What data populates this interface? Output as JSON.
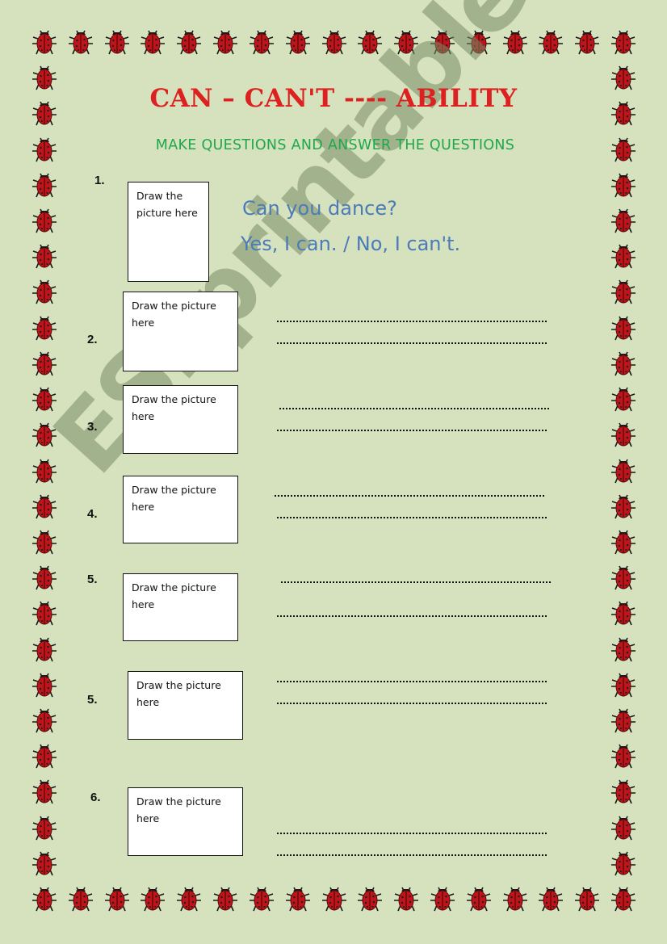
{
  "worksheet": {
    "title": "CAN – CAN'T ---- ABILITY",
    "instruction": "MAKE QUESTIONS AND ANSWER THE QUESTIONS",
    "example": {
      "question": "Can you dance?",
      "answer": "Yes, I can. / No, I can't."
    },
    "items": [
      {
        "number": "1.",
        "box_label": "Draw the picture here"
      },
      {
        "number": "2.",
        "box_label": "Draw the picture here"
      },
      {
        "number": "3.",
        "box_label": "Draw the picture here"
      },
      {
        "number": "4.",
        "box_label": "Draw the picture here"
      },
      {
        "number": "5.",
        "box_label": "Draw the picture here"
      },
      {
        "number": "5.",
        "box_label": "Draw the picture here"
      },
      {
        "number": "6.",
        "box_label": "Draw the picture here"
      }
    ],
    "answer_line_text": "",
    "watermark": "ESLprintables.com"
  },
  "border": {
    "icon": "ladybug-icon",
    "colors": {
      "body": "#c0141a",
      "outline": "#1a1a1a",
      "background": "#d6e1bd"
    }
  }
}
